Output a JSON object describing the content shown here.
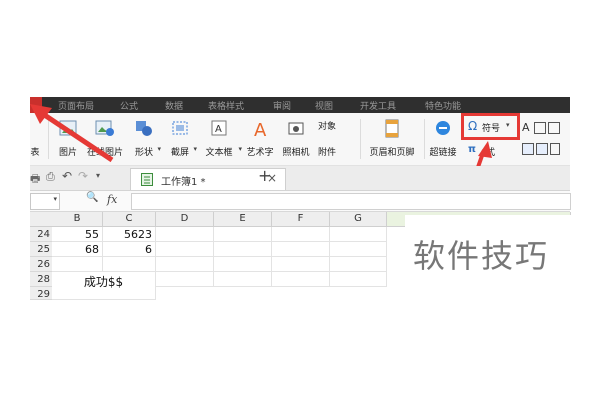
{
  "menu": {
    "tabs": [
      "页面布局",
      "公式",
      "数据",
      "表格样式",
      "审阅",
      "视图",
      "开发工具",
      "特色功能"
    ]
  },
  "ribbon": {
    "table_label": "表",
    "picture": "图片",
    "online_picture": "在线图片",
    "shapes": "形状",
    "screenshot": "截屏",
    "textbox": "文本框",
    "wordart": "艺术字",
    "camera": "照相机",
    "object": "对象",
    "attachment": "附件",
    "header_footer": "页眉和页脚",
    "hyperlink": "超链接",
    "symbol": "符号",
    "formula_partial": "式"
  },
  "tabs": {
    "doc_name": "工作簿1 *",
    "close": "×",
    "add": "+"
  },
  "formula_bar": {
    "zoom_symbol": "🔍",
    "fx": "fx"
  },
  "grid": {
    "columns": [
      "B",
      "C",
      "D",
      "E",
      "F",
      "G"
    ],
    "rows": [
      {
        "row": "24",
        "B": "55",
        "C": "5623"
      },
      {
        "row": "25",
        "B": "68",
        "C": "6"
      },
      {
        "row": "26",
        "B": "",
        "C": ""
      },
      {
        "row": "28",
        "B": "成功$$",
        "C": ""
      },
      {
        "row": "29",
        "B": "",
        "C": ""
      }
    ]
  },
  "watermark": "软件技巧",
  "colors": {
    "annotation": "#e53935",
    "menubar": "#2f2f2f"
  }
}
